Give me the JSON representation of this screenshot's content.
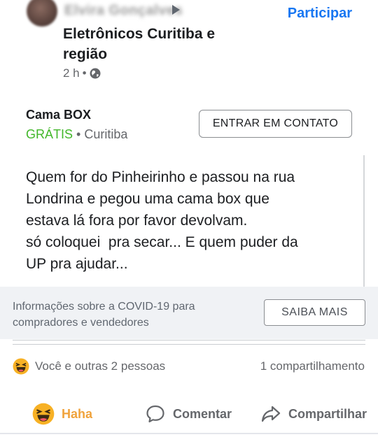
{
  "post": {
    "author": "Elvira Gonçalves",
    "group": "Eletrônicos Curitiba e região",
    "time": "2 h",
    "separator": "•",
    "join_label": "Participar"
  },
  "listing": {
    "title": "Cama BOX",
    "price": "GRÁTIS",
    "separator": "•",
    "location": "Curitiba",
    "contact_label": "ENTRAR EM CONTATO"
  },
  "body": {
    "lines": [
      "Quem for do Pinheirinho e passou na rua",
      "Londrina e pegou uma cama box que",
      "estava lá fora por favor devolvam.",
      "só coloquei  pra secar... E quem puder da",
      "UP pra ajudar..."
    ]
  },
  "covid": {
    "text": "Informações sobre a COVID-19 para compradores e vendedores",
    "button": "SAIBA MAIS"
  },
  "reactions": {
    "summary": "Você e outras 2 pessoas",
    "shares": "1 compartilhamento"
  },
  "actions": {
    "haha": "Haha",
    "comment": "Comentar",
    "share": "Compartilhar"
  },
  "colors": {
    "link": "#1877f2",
    "free": "#42b72a",
    "haha": "#f0a33c",
    "emoji_face": "#f7b125"
  }
}
